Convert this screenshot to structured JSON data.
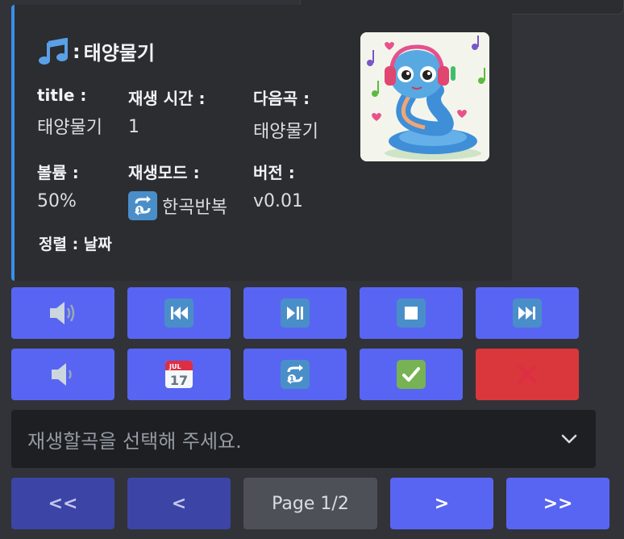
{
  "embed": {
    "title": "태양물기",
    "accent_color": "#3b8fe8",
    "fields": [
      {
        "name": "title :",
        "value": "태양물기"
      },
      {
        "name": "재생 시간 :",
        "value": "1"
      },
      {
        "name": "다음곡 :",
        "value": "태양물기"
      },
      {
        "name": "볼륨 :",
        "value": "50%"
      },
      {
        "name": "재생모드 :",
        "value": "한곡반복",
        "icon": "repeat-one-icon"
      },
      {
        "name": "버전 :",
        "value": "v0.01"
      }
    ],
    "footer": "정렬 : 날짜",
    "thumbnail": "snake-with-headphones-image"
  },
  "buttons_row1": [
    {
      "icon": "volume-up-icon"
    },
    {
      "icon": "previous-track-icon"
    },
    {
      "icon": "play-pause-icon"
    },
    {
      "icon": "stop-icon"
    },
    {
      "icon": "next-track-icon"
    }
  ],
  "buttons_row2": [
    {
      "icon": "volume-down-icon"
    },
    {
      "icon": "calendar-icon",
      "month": "JUL",
      "day": "17"
    },
    {
      "icon": "repeat-one-icon"
    },
    {
      "icon": "check-mark-icon"
    },
    {
      "icon": "cross-mark-icon",
      "color": "#da373c"
    }
  ],
  "select": {
    "placeholder": "재생할곡을 선택해 주세요."
  },
  "pagination": {
    "first": "<<",
    "prev": "<",
    "page": "Page 1/2",
    "next": ">",
    "last": ">>"
  },
  "colors": {
    "blurple": "#5865f2",
    "danger": "#da373c",
    "background": "#313338",
    "embed_bg": "#2b2d31"
  }
}
